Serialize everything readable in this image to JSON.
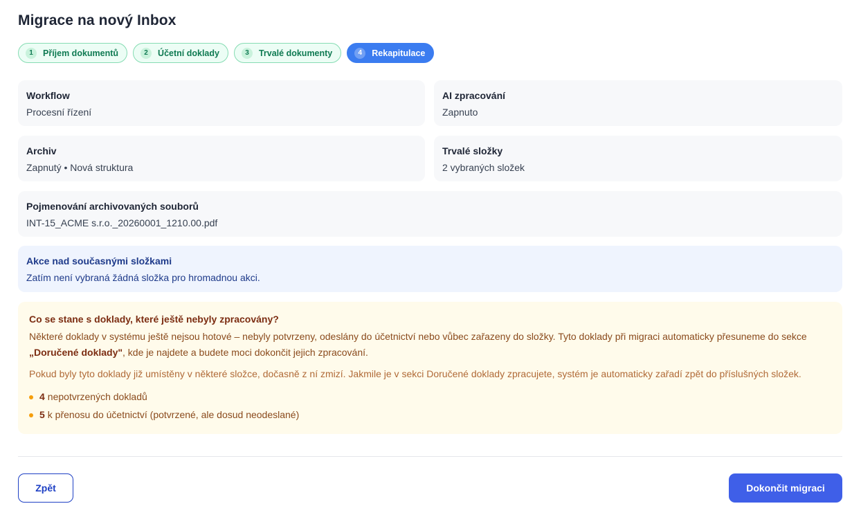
{
  "page": {
    "title": "Migrace na nový Inbox"
  },
  "steps": [
    {
      "num": "1",
      "label": "Příjem dokumentů",
      "state": "done"
    },
    {
      "num": "2",
      "label": "Účetní doklady",
      "state": "done"
    },
    {
      "num": "3",
      "label": "Trvalé dokumenty",
      "state": "done"
    },
    {
      "num": "4",
      "label": "Rekapitulace",
      "state": "active"
    }
  ],
  "summary": {
    "workflow": {
      "label": "Workflow",
      "value": "Procesní řízení"
    },
    "ai": {
      "label": "AI zpracování",
      "value": "Zapnuto"
    },
    "archiv": {
      "label": "Archiv",
      "value": "Zapnutý • Nová struktura"
    },
    "trvale": {
      "label": "Trvalé složky",
      "value": "2 vybraných složek"
    },
    "naming": {
      "label": "Pojmenování archivovaných souborů",
      "value": "INT-15_ACME s.r.o._20260001_1210.00.pdf"
    }
  },
  "actions": {
    "label": "Akce nad současnými složkami",
    "value": "Zatím není vybraná žádná složka pro hromadnou akci."
  },
  "warning": {
    "title": "Co se stane s doklady, které ještě nebyly zpracovány?",
    "p1_before": "Některé doklady v systému ještě nejsou hotové – nebyly potvrzeny, odeslány do účetnictví nebo vůbec zařazeny do složky. Tyto doklady při migraci automaticky přesuneme do sekce ",
    "p1_bold": "„Doručené doklady\"",
    "p1_after": ", kde je najdete a budete moci dokončit jejich zpracování.",
    "p2": "Pokud byly tyto doklady již umístěny v některé složce, dočasně z ní zmizí. Jakmile je v sekci Doručené doklady zpracujete, systém je automaticky zařadí zpět do příslušných složek.",
    "items": [
      {
        "count": "4",
        "text": "nepotvrzených dokladů"
      },
      {
        "count": "5",
        "text": "k přenosu do účetnictví (potvrzené, ale dosud neodeslané)"
      }
    ]
  },
  "footer": {
    "back_label": "Zpět",
    "finish_label": "Dokončit migraci"
  },
  "colors": {
    "accent": "#3b7cf0",
    "primary_button": "#3f5fe8",
    "step_done": "#0f7a52",
    "warning_bg": "#fffbeb"
  }
}
